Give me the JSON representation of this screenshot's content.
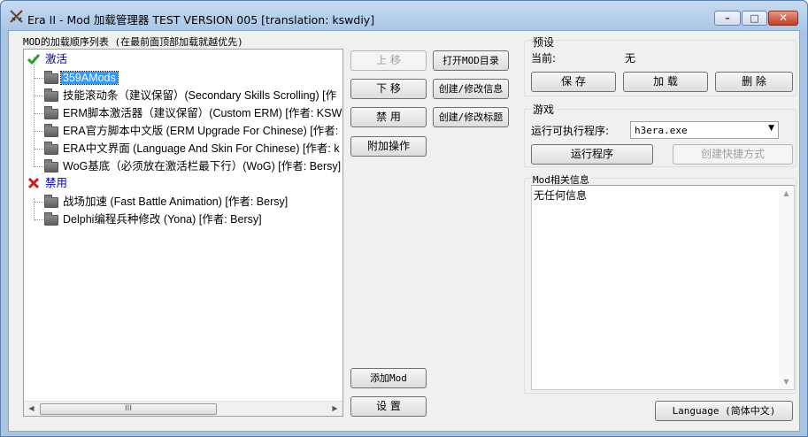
{
  "window": {
    "title": "Era II - Mod 加载管理器 TEST VERSION 005 [translation: kswdiy]",
    "controls": {
      "minimize": "–",
      "maximize": "□",
      "close": "✕"
    }
  },
  "mod_list": {
    "label": "MOD的加载顺序列表 (在最前面顶部加载就越优先)",
    "active_group": "激活",
    "active_items": [
      "359AMods",
      "技能滚动条（建议保留）(Secondary Skills Scrolling) [作",
      "ERM脚本激活器（建议保留）(Custom ERM) [作者: KSW",
      "ERA官方脚本中文版 (ERM Upgrade For Chinese) [作者:",
      "ERA中文界面 (Language And Skin For Chinese) [作者: k",
      "WoG基底（必须放在激活栏最下行）(WoG) [作者: Bersy]"
    ],
    "disabled_group": "禁用",
    "disabled_items": [
      "战场加速 (Fast Battle Animation) [作者: Bersy]",
      "Delphi编程兵种修改 (Yona) [作者: Bersy]"
    ],
    "scroll_thumb_grip": "III"
  },
  "actions": {
    "move_up": "上 移",
    "move_down": "下 移",
    "disable": "禁 用",
    "extra_ops": "附加操作",
    "open_mod_dir": "打开MOD目录",
    "edit_info": "创建/修改信息",
    "edit_title": "创建/修改标题",
    "add_mod": "添加Mod",
    "settings": "设 置"
  },
  "preset": {
    "group_label": "预设",
    "current_label": "当前:",
    "current_value": "无",
    "save": "保 存",
    "load": "加 载",
    "delete": "删 除"
  },
  "game": {
    "group_label": "游戏",
    "exe_label": "运行可执行程序:",
    "exe_value": "h3era.exe",
    "run": "运行程序",
    "create_shortcut": "创建快捷方式"
  },
  "mod_info": {
    "group_label": "Mod相关信息",
    "text": "无任何信息"
  },
  "language_button": "Language (简体中文)"
}
